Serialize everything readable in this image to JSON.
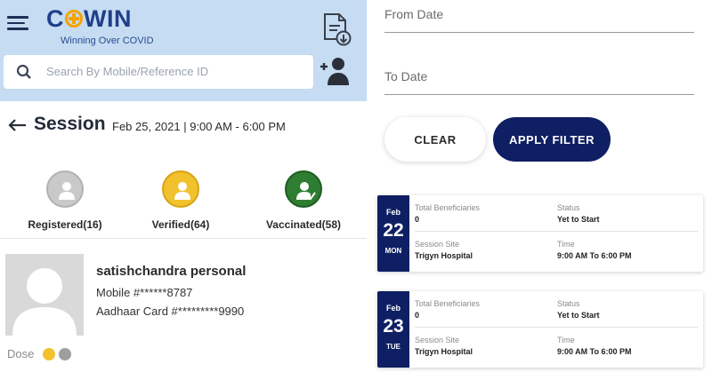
{
  "app": {
    "logo_text_before": "C",
    "logo_text_after": "WIN",
    "tagline": "Winning Over COVID"
  },
  "search": {
    "placeholder": "Search By Mobile/Reference ID"
  },
  "session": {
    "title": "Session",
    "date_time": "Feb 25, 2021 | 9:00 AM - 6:00 PM"
  },
  "status_tabs": [
    {
      "label": "Registered(16)",
      "color": "#c9c9c9"
    },
    {
      "label": "Verified(64)",
      "color": "#f2c12e"
    },
    {
      "label": "Vaccinated(58)",
      "color": "#2e7d32"
    }
  ],
  "beneficiary": {
    "name": "satishchandra personal",
    "mobile": "Mobile #******8787",
    "aadhaar": "Aadhaar Card #*********9990",
    "dose_label": "Dose"
  },
  "filter": {
    "from_label": "From Date",
    "to_label": "To Date",
    "clear_label": "CLEAR",
    "apply_label": "APPLY FILTER"
  },
  "cards": [
    {
      "month": "Feb",
      "day": "22",
      "weekday": "MON",
      "total_caption": "Total Beneficiaries",
      "total_value": "0",
      "status_caption": "Status",
      "status_value": "Yet to Start",
      "site_caption": "Session Site",
      "site_value": "Trigyn Hospital",
      "time_caption": "Time",
      "time_value": "9:00 AM To 6:00 PM"
    },
    {
      "month": "Feb",
      "day": "23",
      "weekday": "TUE",
      "total_caption": "Total Beneficiaries",
      "total_value": "0",
      "status_caption": "Status",
      "status_value": "Yet to Start",
      "site_caption": "Session Site",
      "site_value": "Trigyn Hospital",
      "time_caption": "Time",
      "time_value": "9:00 AM To 6:00 PM"
    }
  ],
  "colors": {
    "header_bg": "#c5dcf2",
    "brand_navy": "#0f1f63",
    "logo_blue": "#1f3f8a",
    "logo_orange": "#f4a300"
  },
  "icons": [
    "menu-icon",
    "download-document-icon",
    "search-icon",
    "add-user-icon",
    "back-arrow-icon",
    "registered-user-icon",
    "verified-user-icon",
    "vaccinated-user-icon",
    "avatar-placeholder-icon"
  ]
}
